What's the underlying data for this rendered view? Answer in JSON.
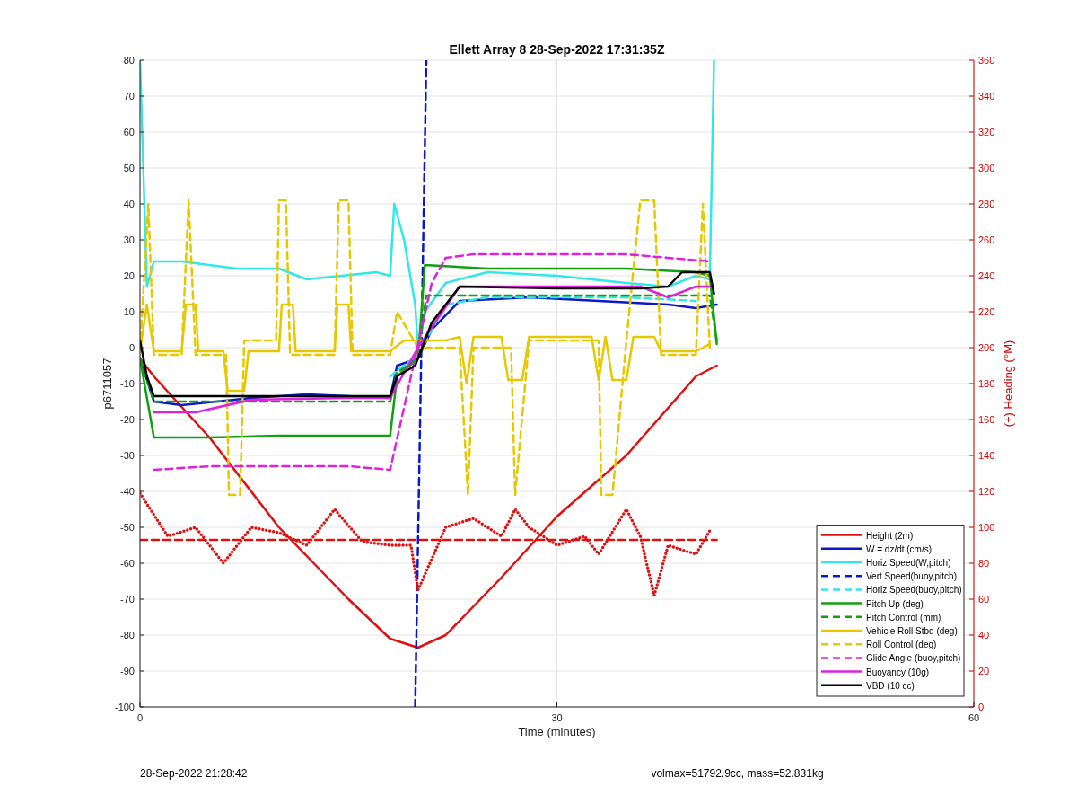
{
  "figure": {
    "chart_data": {
      "type": "line",
      "title": "Ellett Array 8 28-Sep-2022 17:31:35Z",
      "xlabel": "Time (minutes)",
      "ylabel": "p6711057",
      "y2label": "(+) Heading (°M)",
      "grid": true,
      "legend": "lower right",
      "xlim": [
        0,
        60
      ],
      "ylim": [
        -100,
        80
      ],
      "y2lim": [
        0,
        360
      ],
      "xticks": [
        0,
        30,
        60
      ],
      "yticks": [
        -100,
        -90,
        -80,
        -70,
        -60,
        -50,
        -40,
        -30,
        -20,
        -10,
        0,
        10,
        20,
        30,
        40,
        50,
        60,
        70,
        80
      ],
      "y2ticks": [
        0,
        20,
        40,
        60,
        80,
        100,
        120,
        140,
        160,
        180,
        200,
        220,
        240,
        260,
        280,
        300,
        320,
        340,
        360
      ],
      "series": [
        {
          "name": "Height (2m)",
          "color": "#e01010",
          "x": [
            0,
            1,
            5,
            10,
            15,
            18,
            20,
            22,
            26,
            30,
            35,
            40,
            41.5
          ],
          "values": [
            -3,
            -8,
            -25,
            -50,
            -70,
            -81,
            -83.5,
            -80,
            -64,
            -47,
            -30,
            -8,
            -5
          ]
        },
        {
          "name": "W = dz/dt (cm/s)",
          "color": "#0a18c8",
          "x": [
            0,
            1,
            3,
            8,
            12,
            18,
            18.5,
            20,
            21,
            23,
            28,
            33,
            38,
            40,
            41.5
          ],
          "values": [
            -3,
            -15,
            -16,
            -14,
            -13,
            -14,
            -5,
            -3,
            5,
            13,
            14,
            13,
            12,
            11,
            12
          ]
        },
        {
          "name": "Horiz Speed(W,pitch)",
          "color": "#30e8e8",
          "x": [
            0,
            0.5,
            1,
            3,
            7,
            10,
            12,
            17,
            18,
            18.3,
            19,
            19.8,
            20,
            20.5,
            22,
            25,
            30,
            35,
            38,
            40,
            41,
            41.3
          ],
          "values": [
            80,
            17,
            24,
            24,
            22,
            22,
            19,
            21,
            20,
            40,
            30,
            12,
            0,
            10,
            18,
            21,
            20,
            18,
            17,
            20,
            19,
            80
          ]
        },
        {
          "name": "Vert Speed(buoy,pitch)",
          "color": "#0a18c8",
          "line_style": "dashed",
          "x": [
            19.8,
            20.6
          ],
          "values": [
            -100,
            80
          ]
        },
        {
          "name": "Horiz Speed(buoy,pitch)",
          "color": "#30e8e8",
          "line_style": "dashed",
          "x": [
            18,
            20,
            22,
            25,
            30,
            35,
            40
          ],
          "values": [
            -8,
            -2,
            12,
            14,
            14,
            14,
            13
          ]
        },
        {
          "name": "Pitch Up (deg)",
          "color": "#10a010",
          "x": [
            0,
            1,
            5,
            10,
            18,
            18.5,
            20,
            20.5,
            25,
            30,
            35,
            40,
            41,
            41.5
          ],
          "values": [
            -3,
            -25,
            -25,
            -24.5,
            -24.5,
            -8,
            -3,
            23,
            22,
            22,
            22,
            21,
            20,
            1
          ]
        },
        {
          "name": "Pitch Control (mm)",
          "color": "#10a010",
          "line_style": "dashed",
          "x": [
            0,
            1,
            18,
            18.5,
            20,
            20.6,
            30,
            41,
            41.5
          ],
          "values": [
            -3,
            -15,
            -15,
            -7,
            -3,
            14.5,
            14.5,
            14.5,
            2
          ]
        },
        {
          "name": "Vehicle Roll Stbd (deg)",
          "color": "#e6c800",
          "x": [
            0,
            0.5,
            1,
            3,
            3.3,
            4,
            4.2,
            6,
            6.3,
            7.5,
            7.8,
            10,
            10.2,
            11,
            11.2,
            14,
            14.2,
            15,
            15.2,
            18,
            19,
            22,
            23,
            23.5,
            24,
            26,
            26.5,
            27.5,
            28,
            32.5,
            33,
            33.5,
            34,
            35,
            35.5,
            37,
            37.5,
            40,
            41
          ],
          "values": [
            -1,
            12,
            -1,
            -1,
            12,
            12,
            -1,
            -1,
            -12,
            -12,
            -1,
            -1,
            12,
            12,
            -1,
            -1,
            12,
            12,
            -1,
            -1,
            2,
            2,
            3,
            -10,
            3,
            3,
            -9,
            -9,
            3,
            3,
            -9,
            3,
            -9,
            -9,
            3,
            3,
            -1,
            -1,
            1
          ]
        },
        {
          "name": "Roll Control (deg)",
          "color": "#e6c800",
          "line_style": "dashed",
          "x": [
            0,
            0.6,
            1,
            3,
            3.5,
            4,
            6.2,
            6.4,
            7.2,
            7.5,
            9.8,
            10,
            10.5,
            10.8,
            14,
            14.3,
            15,
            15.3,
            18,
            18.5,
            20,
            23,
            23.6,
            24,
            26.7,
            27,
            28,
            33,
            33.2,
            34,
            35,
            36,
            37,
            37.5,
            40,
            40.5,
            41
          ],
          "values": [
            -1,
            40,
            -2,
            -2,
            41,
            -2,
            -2,
            -41,
            -41,
            2,
            2,
            41,
            41,
            -2,
            -2,
            41,
            41,
            -2,
            -2,
            10,
            0,
            0,
            -41,
            0,
            0,
            -41,
            2,
            2,
            -41,
            -41,
            2,
            41,
            41,
            -2,
            -2,
            40,
            0
          ]
        },
        {
          "name": "Glide Angle (buoy,pitch)",
          "color": "#e020e0",
          "line_style": "dashed",
          "x": [
            1,
            5,
            10,
            15,
            18,
            21,
            22,
            24,
            30,
            35,
            38,
            41
          ],
          "values": [
            -34,
            -33,
            -33,
            -33,
            -34,
            18,
            25,
            26,
            26,
            26,
            25,
            24
          ]
        },
        {
          "name": "Buoyancy (10g)",
          "color": "#e020e0",
          "x": [
            1,
            4,
            8,
            15,
            18,
            20,
            23,
            30,
            36,
            38,
            40,
            41
          ],
          "values": [
            -18,
            -18,
            -14.5,
            -14,
            -14,
            0,
            17,
            17,
            17,
            14,
            17,
            17
          ]
        },
        {
          "name": "VBD (10 cc)",
          "color": "#000000",
          "x": [
            0,
            0.5,
            1,
            18,
            18.5,
            19.8,
            21,
            23,
            30,
            36,
            38,
            39,
            41,
            41.3
          ],
          "values": [
            2,
            -8,
            -13.5,
            -13.5,
            -8,
            -5,
            7,
            17,
            16.5,
            16.5,
            17,
            21,
            21,
            15
          ]
        },
        {
          "color": "#e01010",
          "axis": "y2",
          "line_style": "dotted",
          "x": [
            0,
            2,
            4,
            6,
            8,
            10,
            12,
            14,
            16,
            18,
            19.5,
            20,
            22,
            24,
            26,
            27,
            28,
            30,
            32,
            33,
            35,
            36,
            37,
            38,
            40,
            41
          ],
          "values": [
            119,
            95,
            100,
            80,
            100,
            97,
            90,
            110,
            92,
            90,
            90,
            65,
            100,
            105,
            95,
            110,
            100,
            90,
            95,
            85,
            110,
            95,
            62,
            90,
            85,
            98
          ]
        },
        {
          "color": "#e01010",
          "axis": "y2",
          "line_style": "dashed",
          "x": [
            0,
            41.5
          ],
          "values": [
            93,
            93
          ]
        }
      ]
    }
  },
  "footer": {
    "timestamp": "28-Sep-2022 21:28:42",
    "summary": "volmax=51792.9cc, mass=52.831kg"
  }
}
